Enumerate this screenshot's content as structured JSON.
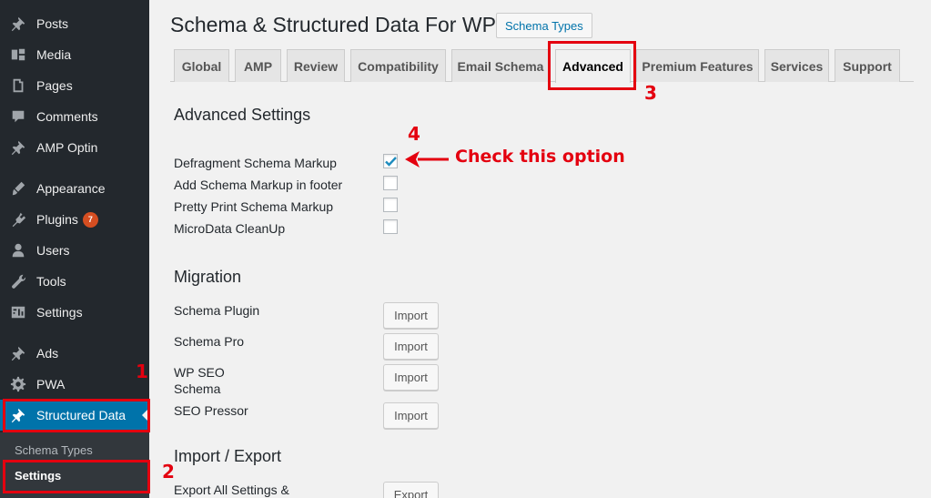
{
  "sidebar": {
    "items": [
      {
        "label": "Posts",
        "icon": "pin-icon"
      },
      {
        "label": "Media",
        "icon": "media-icon"
      },
      {
        "label": "Pages",
        "icon": "pages-icon"
      },
      {
        "label": "Comments",
        "icon": "comment-icon"
      },
      {
        "label": "AMP Optin",
        "icon": "pin-icon"
      },
      {
        "label": "Appearance",
        "icon": "brush-icon"
      },
      {
        "label": "Plugins",
        "icon": "plugin-icon",
        "badge": "7"
      },
      {
        "label": "Users",
        "icon": "user-icon"
      },
      {
        "label": "Tools",
        "icon": "wrench-icon"
      },
      {
        "label": "Settings",
        "icon": "settings-icon"
      },
      {
        "label": "Ads",
        "icon": "pin-icon"
      },
      {
        "label": "PWA",
        "icon": "gear-icon"
      },
      {
        "label": "Structured Data",
        "icon": "pin-icon"
      }
    ],
    "submenu": [
      {
        "label": "Schema Types"
      },
      {
        "label": "Settings"
      }
    ]
  },
  "header": {
    "title": "Schema & Structured Data For WP",
    "schema_types_button": "Schema Types"
  },
  "tabs": [
    {
      "label": "Global"
    },
    {
      "label": "AMP"
    },
    {
      "label": "Review"
    },
    {
      "label": "Compatibility"
    },
    {
      "label": "Email Schema"
    },
    {
      "label": "Advanced"
    },
    {
      "label": "Premium Features"
    },
    {
      "label": "Services"
    },
    {
      "label": "Support"
    }
  ],
  "advanced": {
    "title": "Advanced Settings",
    "options": [
      {
        "label": "Defragment Schema Markup",
        "checked": true
      },
      {
        "label": "Add Schema Markup in footer",
        "checked": false
      },
      {
        "label": "Pretty Print Schema Markup",
        "checked": false
      },
      {
        "label": "MicroData CleanUp",
        "checked": false
      }
    ]
  },
  "migration": {
    "title": "Migration",
    "rows": [
      {
        "label": "Schema Plugin",
        "button": "Import"
      },
      {
        "label": "Schema Pro",
        "button": "Import"
      },
      {
        "label_line1": "WP SEO",
        "label_line2": "Schema",
        "button": "Import"
      },
      {
        "label": "SEO Pressor",
        "button": "Import"
      }
    ]
  },
  "import_export": {
    "title": "Import / Export",
    "row_label": "Export All Settings &",
    "button": "Export"
  },
  "annotations": {
    "n1": "1",
    "n2": "2",
    "n3": "3",
    "n4": "4",
    "callout": "Check this option",
    "color": "#e4000f"
  }
}
